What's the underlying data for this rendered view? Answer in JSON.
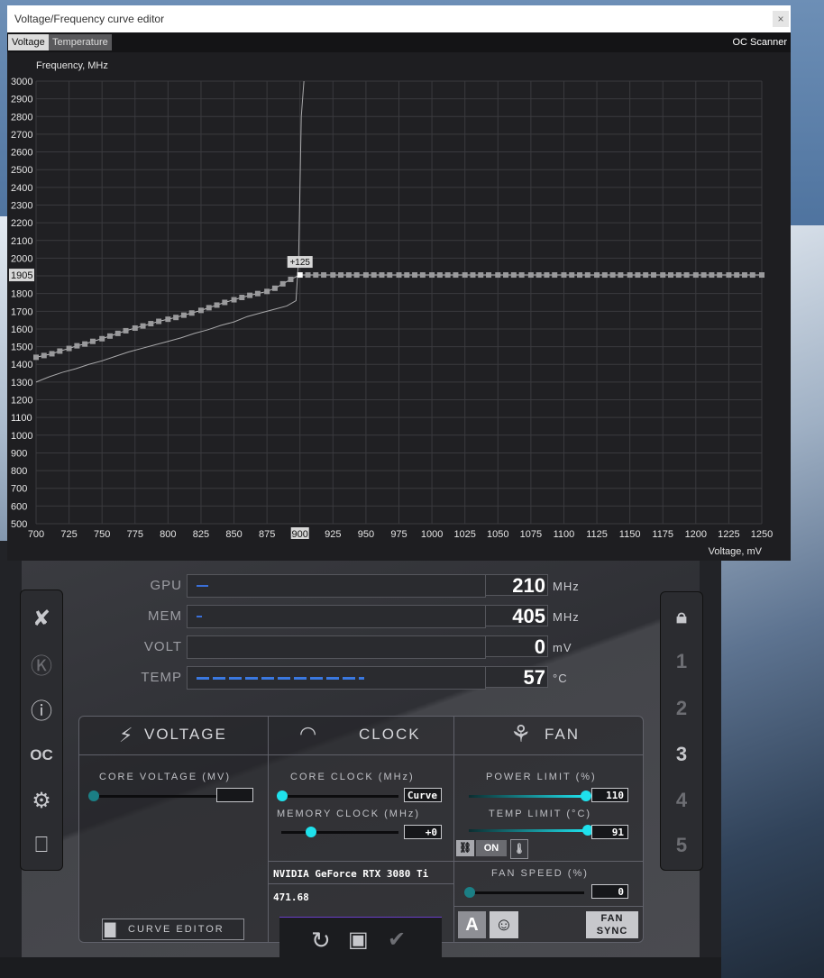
{
  "window": {
    "title": "Voltage/Frequency curve editor",
    "close": "×"
  },
  "tabs": [
    {
      "label": "Voltage",
      "active": true
    },
    {
      "label": "Temperature",
      "active": false
    }
  ],
  "oc_scanner": "OC Scanner",
  "chart_data": {
    "type": "line",
    "ylabel": "Frequency, MHz",
    "xlabel": "Voltage, mV",
    "xlim": [
      700,
      1250
    ],
    "ylim": [
      500,
      3000
    ],
    "x_ticks": [
      "700",
      "725",
      "750",
      "775",
      "800",
      "825",
      "850",
      "875",
      "900",
      "925",
      "950",
      "975",
      "1000",
      "1025",
      "1050",
      "1075",
      "1100",
      "1125",
      "1150",
      "1175",
      "1200",
      "1225",
      "1250"
    ],
    "y_ticks": [
      "500",
      "600",
      "700",
      "800",
      "900",
      "1000",
      "1100",
      "1200",
      "1300",
      "1400",
      "1500",
      "1600",
      "1700",
      "1800",
      "1900",
      "2000",
      "2100",
      "2200",
      "2300",
      "2400",
      "2500",
      "2600",
      "2700",
      "2800",
      "2900",
      "3000"
    ],
    "highlight_x": "900",
    "highlight_y": "1905",
    "point_label": "+125",
    "series": [
      {
        "x": [
          700,
          706,
          712,
          718,
          725,
          731,
          737,
          743,
          750,
          756,
          762,
          768,
          775,
          781,
          787,
          793,
          800,
          806,
          812,
          818,
          825,
          831,
          837,
          843,
          850,
          856,
          862,
          868,
          875,
          881,
          887,
          893,
          900,
          906,
          912,
          918,
          925,
          931,
          937,
          943,
          950,
          956,
          962,
          968,
          975,
          981,
          987,
          993,
          1000,
          1006,
          1012,
          1018,
          1025,
          1031,
          1037,
          1043,
          1050,
          1056,
          1062,
          1068,
          1075,
          1081,
          1087,
          1093,
          1100,
          1106,
          1112,
          1118,
          1125,
          1131,
          1137,
          1143,
          1150,
          1156,
          1162,
          1168,
          1175,
          1181,
          1187,
          1193,
          1200,
          1206,
          1212,
          1218,
          1225,
          1231,
          1237,
          1243,
          1250
        ],
        "y": [
          1440,
          1450,
          1460,
          1475,
          1490,
          1505,
          1515,
          1530,
          1545,
          1560,
          1575,
          1590,
          1605,
          1617,
          1630,
          1643,
          1655,
          1665,
          1678,
          1690,
          1705,
          1720,
          1735,
          1750,
          1765,
          1778,
          1790,
          1800,
          1812,
          1830,
          1855,
          1880,
          1905,
          1905,
          1905,
          1905,
          1905,
          1905,
          1905,
          1905,
          1905,
          1905,
          1905,
          1905,
          1905,
          1905,
          1905,
          1905,
          1905,
          1905,
          1905,
          1905,
          1905,
          1905,
          1905,
          1905,
          1905,
          1905,
          1905,
          1905,
          1905,
          1905,
          1905,
          1905,
          1905,
          1905,
          1905,
          1905,
          1905,
          1905,
          1905,
          1905,
          1905,
          1905,
          1905,
          1905,
          1905,
          1905,
          1905,
          1905,
          1905,
          1905,
          1905,
          1905,
          1905,
          1905,
          1905,
          1905,
          1905
        ]
      },
      {
        "x": [
          700,
          710,
          720,
          730,
          740,
          750,
          760,
          770,
          780,
          790,
          800,
          810,
          820,
          830,
          840,
          850,
          860,
          870,
          880,
          890,
          897,
          899,
          900,
          901,
          903
        ],
        "y": [
          1300,
          1330,
          1355,
          1375,
          1400,
          1420,
          1445,
          1470,
          1490,
          1510,
          1530,
          1550,
          1575,
          1595,
          1620,
          1640,
          1670,
          1690,
          1710,
          1730,
          1760,
          2000,
          2400,
          2800,
          3000
        ]
      }
    ]
  },
  "readouts": [
    {
      "label": "GPU",
      "value": "210",
      "unit": "MHz",
      "fill": 0.04
    },
    {
      "label": "MEM",
      "value": "405",
      "unit": "MHz",
      "fill": 0.02
    },
    {
      "label": "VOLT",
      "value": "0",
      "unit": "mV",
      "fill": 0
    },
    {
      "label": "TEMP",
      "value": "57",
      "unit": "°C",
      "fill": 0.58
    }
  ],
  "sections": {
    "voltage": "VOLTAGE",
    "clock": "CLOCK",
    "fan": "FAN"
  },
  "controls": {
    "core_voltage_label": "CORE VOLTAGE  (MV)",
    "core_voltage_value": "",
    "core_clock_label": "CORE CLOCK (MHz)",
    "core_clock_value": "Curve",
    "memory_clock_label": "MEMORY CLOCK (MHz)",
    "memory_clock_value": "+0",
    "power_limit_label": "POWER LIMIT (%)",
    "power_limit_value": "110",
    "temp_limit_label": "TEMP LIMIT (°C)",
    "temp_limit_value": "91",
    "link_on": "ON",
    "fan_speed_label": "FAN SPEED (%)",
    "fan_speed_value": "0",
    "gpu_name": "NVIDIA GeForce RTX 3080 Ti",
    "driver": "471.68",
    "curve_editor": "CURVE EDITOR",
    "fan_auto": "A",
    "fan_sync": "FAN SYNC"
  },
  "profiles": [
    "1",
    "2",
    "3",
    "4",
    "5"
  ]
}
